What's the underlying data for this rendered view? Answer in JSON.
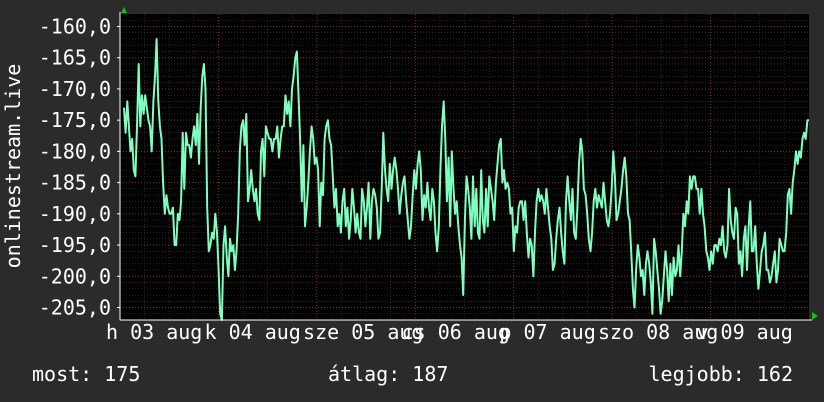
{
  "chart_data": {
    "type": "line",
    "title": "",
    "ylabel": "onlinestream.live",
    "xlabel": "",
    "ylim": [
      -207,
      -158
    ],
    "xlim": [
      0,
      100
    ],
    "y_ticks": [
      "-160,0",
      "-165,0",
      "-170,0",
      "-175,0",
      "-180,0",
      "-185,0",
      "-190,0",
      "-195,0",
      "-200,0",
      "-205,0"
    ],
    "y_tick_values": [
      -160,
      -165,
      -170,
      -175,
      -180,
      -185,
      -190,
      -195,
      -200,
      -205
    ],
    "x_tick_labels": [
      "h 03 aug",
      "k 04 aug",
      "sze 05 aug",
      "cs 06 aug",
      "p 07 aug",
      "szo 08 aug",
      "v 09 aug"
    ],
    "x_tick_positions": [
      0,
      14.3,
      28.6,
      42.9,
      57.1,
      71.4,
      85.7
    ],
    "grid": true,
    "colors": {
      "line": "#7fffbf",
      "background": "#000000",
      "grid": "#8b2a2a",
      "axis": "#ffffff",
      "arrow": "#00cc00"
    },
    "series": [
      {
        "name": "",
        "values": [
          -173,
          -177,
          -172,
          -176,
          -180,
          -178,
          -183,
          -184,
          -176,
          -166,
          -176,
          -171,
          -174,
          -171,
          -173,
          -175,
          -176,
          -180,
          -172,
          -168,
          -162,
          -172,
          -176,
          -178,
          -185,
          -190,
          -187,
          -189,
          -190,
          -190,
          -189,
          -195,
          -195,
          -190,
          -191,
          -188,
          -177,
          -186,
          -177,
          -179,
          -179,
          -181,
          -178,
          -176,
          -179,
          -174,
          -182,
          -173,
          -168,
          -166,
          -170,
          -189,
          -196,
          -195,
          -193,
          -194,
          -190,
          -193,
          -199,
          -206,
          -207,
          -195,
          -192,
          -197,
          -200,
          -194,
          -196,
          -195,
          -199,
          -196,
          -190,
          -180,
          -176,
          -175,
          -179,
          -174,
          -188,
          -186,
          -183,
          -186,
          -188,
          -186,
          -190,
          -191,
          -180,
          -178,
          -184,
          -176,
          -177,
          -178,
          -178,
          -180,
          -178,
          -178,
          -176,
          -181,
          -178,
          -176,
          -176,
          -171,
          -174,
          -172,
          -176,
          -170,
          -168,
          -165,
          -164,
          -171,
          -178,
          -188,
          -179,
          -192,
          -189,
          -185,
          -180,
          -176,
          -178,
          -182,
          -181,
          -183,
          -192,
          -185,
          -187,
          -178,
          -176,
          -175,
          -178,
          -179,
          -184,
          -189,
          -186,
          -192,
          -190,
          -193,
          -188,
          -186,
          -192,
          -189,
          -194,
          -191,
          -186,
          -189,
          -193,
          -190,
          -193,
          -194,
          -186,
          -188,
          -192,
          -189,
          -185,
          -194,
          -188,
          -186,
          -187,
          -189,
          -194,
          -193,
          -186,
          -177,
          -183,
          -186,
          -188,
          -182,
          -186,
          -183,
          -181,
          -183,
          -186,
          -190,
          -187,
          -185,
          -184,
          -188,
          -191,
          -194,
          -192,
          -187,
          -183,
          -186,
          -182,
          -180,
          -183,
          -191,
          -187,
          -189,
          -185,
          -189,
          -191,
          -186,
          -188,
          -193,
          -196,
          -192,
          -183,
          -176,
          -172,
          -178,
          -188,
          -181,
          -192,
          -180,
          -186,
          -190,
          -188,
          -192,
          -195,
          -197,
          -203,
          -191,
          -184,
          -186,
          -189,
          -194,
          -184,
          -192,
          -186,
          -193,
          -194,
          -183,
          -191,
          -193,
          -186,
          -192,
          -184,
          -186,
          -188,
          -191,
          -185,
          -182,
          -179,
          -178,
          -185,
          -183,
          -186,
          -185,
          -186,
          -190,
          -189,
          -196,
          -192,
          -193,
          -189,
          -188,
          -188,
          -191,
          -188,
          -193,
          -197,
          -194,
          -195,
          -200,
          -193,
          -188,
          -186,
          -188,
          -187,
          -188,
          -190,
          -186,
          -189,
          -192,
          -194,
          -199,
          -198,
          -194,
          -191,
          -189,
          -193,
          -196,
          -198,
          -188,
          -184,
          -188,
          -191,
          -186,
          -193,
          -194,
          -189,
          -182,
          -178,
          -180,
          -186,
          -187,
          -190,
          -194,
          -196,
          -193,
          -188,
          -186,
          -189,
          -187,
          -188,
          -189,
          -185,
          -188,
          -191,
          -192,
          -190,
          -186,
          -180,
          -184,
          -191,
          -190,
          -188,
          -186,
          -183,
          -181,
          -184,
          -190,
          -191,
          -196,
          -202,
          -205,
          -199,
          -195,
          -197,
          -200,
          -199,
          -203,
          -198,
          -196,
          -198,
          -201,
          -206,
          -194,
          -196,
          -199,
          -202,
          -206,
          -204,
          -200,
          -196,
          -199,
          -204,
          -198,
          -203,
          -197,
          -200,
          -199,
          -195,
          -200,
          -196,
          -190,
          -192,
          -188,
          -190,
          -184,
          -186,
          -184,
          -184,
          -186,
          -186,
          -190,
          -186,
          -190,
          -192,
          -196,
          -197,
          -199,
          -196,
          -198,
          -195,
          -195,
          -196,
          -194,
          -195,
          -192,
          -196,
          -197,
          -195,
          -186,
          -191,
          -193,
          -194,
          -189,
          -190,
          -198,
          -196,
          -200,
          -194,
          -192,
          -199,
          -192,
          -188,
          -196,
          -196,
          -192,
          -198,
          -202,
          -199,
          -196,
          -195,
          -193,
          -199,
          -199,
          -201,
          -200,
          -198,
          -196,
          -201,
          -199,
          -194,
          -195,
          -196,
          -196,
          -193,
          -187,
          -186,
          -190,
          -185,
          -183,
          -180,
          -182,
          -180,
          -181,
          -178,
          -177,
          -178,
          -175,
          -175
        ]
      }
    ],
    "stats": [
      {
        "label": "most:",
        "value": "175"
      },
      {
        "label": "átlag:",
        "value": "187"
      },
      {
        "label": "legjobb:",
        "value": "162"
      }
    ]
  },
  "stats_text": {
    "now": "most: 175",
    "avg": "átlag: 187",
    "best": "legjobb: 162"
  }
}
